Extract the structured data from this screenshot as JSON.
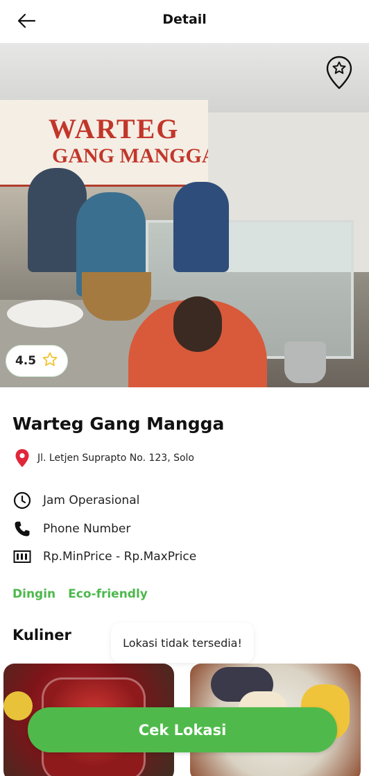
{
  "header": {
    "title": "Detail",
    "back_icon": "arrow-left-icon"
  },
  "hero": {
    "save_icon": "map-pin-star-icon",
    "sign_line1": "WARTEG",
    "sign_line2": "GANG MANGGA"
  },
  "rating": {
    "value": "4.5",
    "icon": "star-outline-icon",
    "icon_color": "#f2c230"
  },
  "place": {
    "name": "Warteg Gang Mangga",
    "address": "Jl. Letjen Suprapto No. 123, Solo",
    "address_icon": "location-pin-icon",
    "address_icon_color": "#e0263a"
  },
  "info": {
    "hours": "Jam Operasional",
    "phone": "Phone Number",
    "price": "Rp.MinPrice - Rp.MaxPrice",
    "hours_icon": "clock-icon",
    "phone_icon": "phone-icon",
    "price_icon": "price-tag-icon"
  },
  "tags": [
    "Dingin",
    "Eco-friendly"
  ],
  "kuliner": {
    "title": "Kuliner"
  },
  "toast": {
    "message": "Lokasi tidak tersedia!"
  },
  "cta": {
    "label": "Cek Lokasi"
  },
  "colors": {
    "accent": "#4fba4b",
    "tag": "#4cb84c"
  }
}
